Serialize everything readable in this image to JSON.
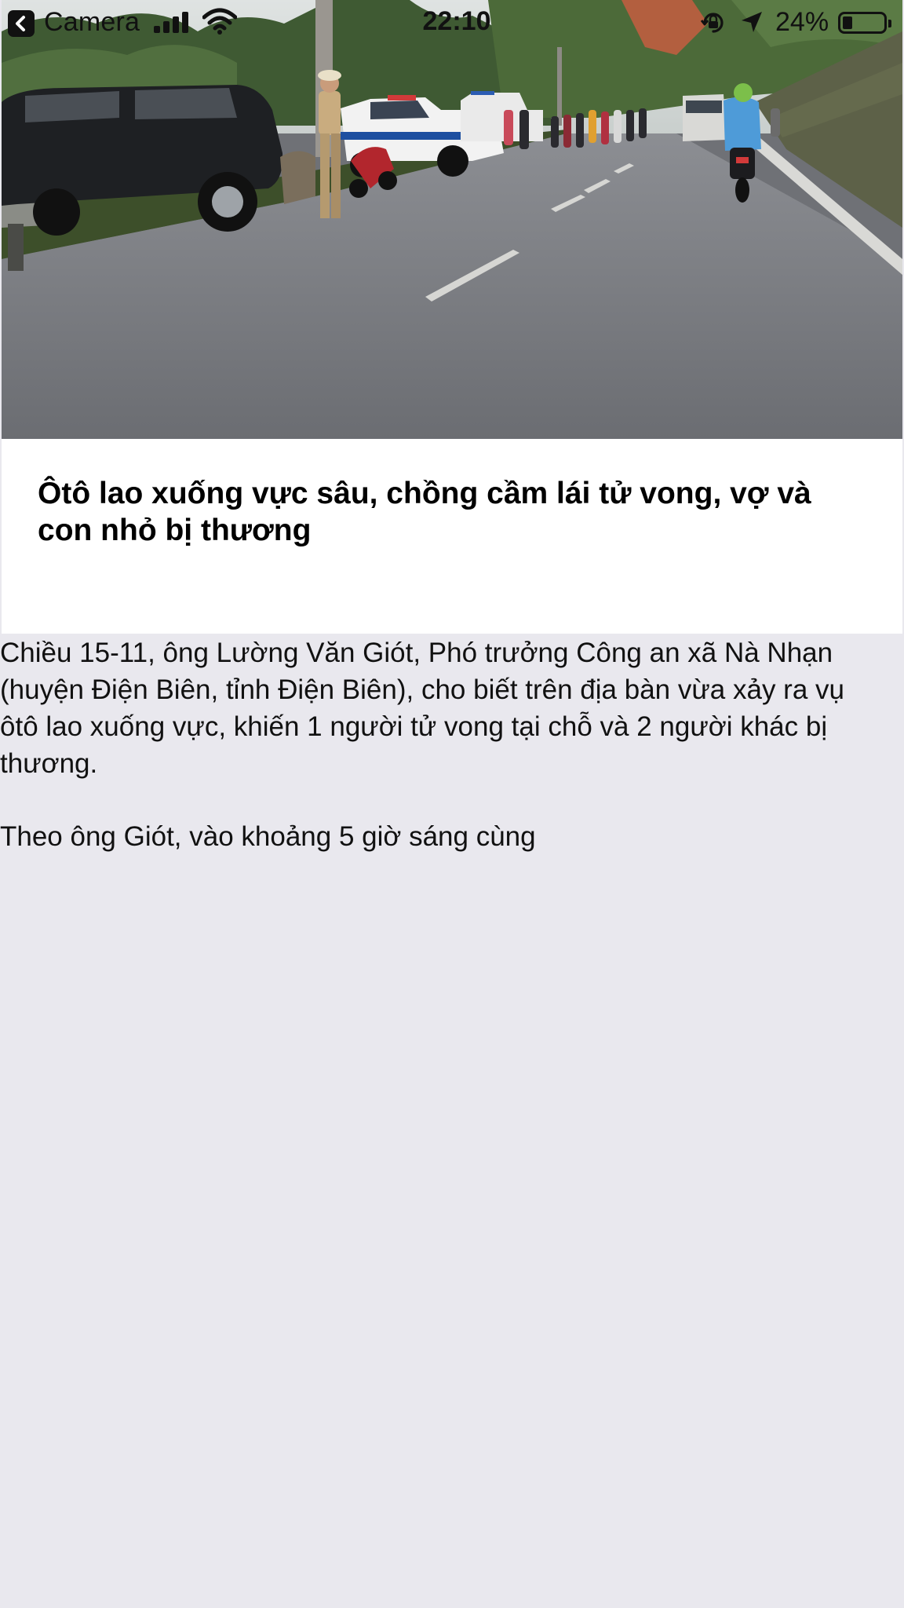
{
  "status_bar": {
    "back_app_label": "Camera",
    "time": "22:10",
    "battery_percent_text": "24%",
    "battery_level": 0.24,
    "signal_bars_filled": 4
  },
  "article": {
    "title": "Ôtô lao xuống vực sâu, chồng cầm lái tử vong, vợ và con nhỏ bị thương",
    "paragraphs": [
      "Chiều 15-11, ông Lường Văn Giót, Phó trưởng Công an xã Nà Nhạn (huyện Điện Biên, tỉnh Điện Biên), cho biết trên địa bàn vừa xảy ra vụ ôtô lao xuống vực, khiến 1 người tử vong tại chỗ và 2 người khác bị thương.",
      "Theo ông Giót, vào khoảng 5 giờ sáng cùng"
    ]
  },
  "icons": {
    "back": "chevron-left-icon",
    "signal": "cellular-signal-icon",
    "wifi": "wifi-icon",
    "rotation_lock": "rotation-lock-icon",
    "location": "location-arrow-icon",
    "battery": "battery-icon"
  },
  "colors": {
    "page_background": "#e9e8ee",
    "card_background": "#ffffff",
    "text": "#111111"
  }
}
